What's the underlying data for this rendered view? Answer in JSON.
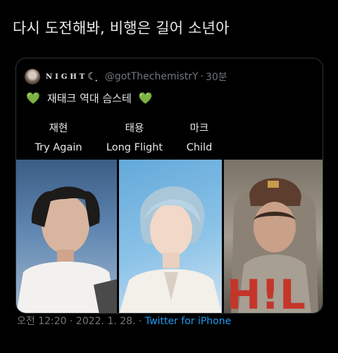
{
  "tweet": {
    "text": "다시 도전해봐, 비행은 길어 소년아"
  },
  "quote": {
    "display_name": "NIGHT",
    "handle": "@gotThechemistrY",
    "separator": "·",
    "time": "30분",
    "headline": "재태크 역대 슴스테",
    "heart_emoji": "💚",
    "lineup": [
      {
        "name": "재현",
        "song": "Try Again"
      },
      {
        "name": "태용",
        "song": "Long Flight"
      },
      {
        "name": "마크",
        "song": "Child"
      }
    ]
  },
  "footer": {
    "time": "오전 12:20",
    "separator": "·",
    "date": "2022. 1. 28.",
    "source": "Twitter for iPhone"
  },
  "colors": {
    "background": "#000000",
    "text": "#e7e9ea",
    "muted": "#71767b",
    "link": "#1d9bf0",
    "heart": "#3ad02e",
    "card_border": "#2f3336"
  }
}
